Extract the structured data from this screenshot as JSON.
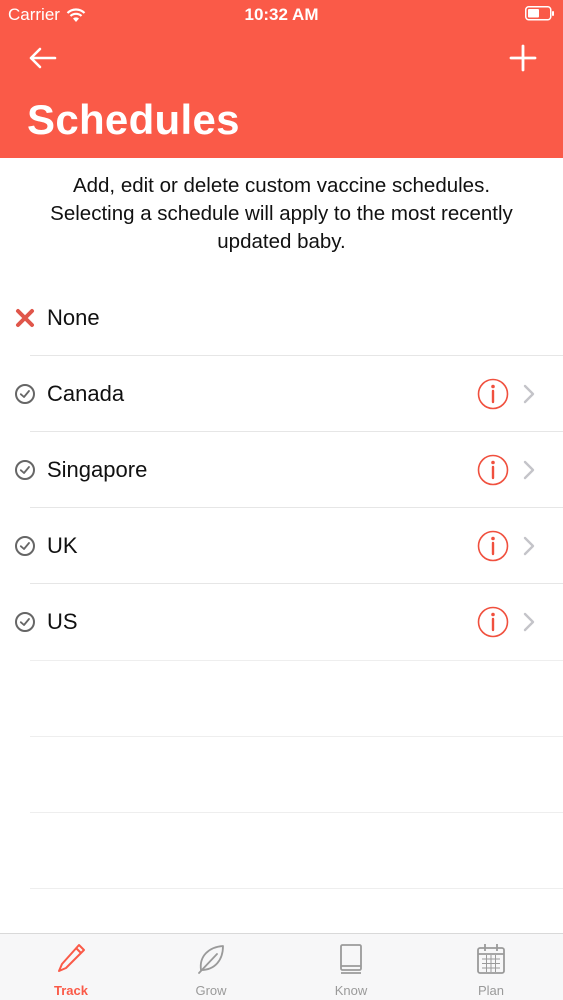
{
  "status_bar": {
    "carrier": "Carrier",
    "time": "10:32 AM"
  },
  "header": {
    "title": "Schedules",
    "back_icon": "arrow-left-icon",
    "add_icon": "plus-icon"
  },
  "description": "Add, edit or delete custom vaccine schedules. Selecting a schedule will apply to the most recently updated baby.",
  "schedules": [
    {
      "label": "None",
      "icon": "x-mark-icon",
      "has_info": false
    },
    {
      "label": "Canada",
      "icon": "clock-icon",
      "has_info": true
    },
    {
      "label": "Singapore",
      "icon": "clock-icon",
      "has_info": true
    },
    {
      "label": "UK",
      "icon": "clock-icon",
      "has_info": true
    },
    {
      "label": "US",
      "icon": "clock-icon",
      "has_info": true
    }
  ],
  "tabs": [
    {
      "label": "Track",
      "icon": "pencil-icon",
      "active": true
    },
    {
      "label": "Grow",
      "icon": "leaf-icon",
      "active": false
    },
    {
      "label": "Know",
      "icon": "book-icon",
      "active": false
    },
    {
      "label": "Plan",
      "icon": "calendar-icon",
      "active": false
    }
  ],
  "colors": {
    "accent": "#fa5a48",
    "inactive": "#9a9a9a"
  }
}
